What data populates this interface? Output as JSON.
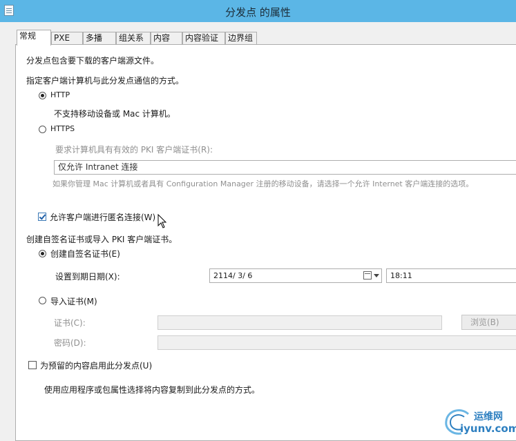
{
  "window": {
    "title": "分发点 的属性"
  },
  "tabs": [
    {
      "label": "常规",
      "active": true
    },
    {
      "label": "PXE"
    },
    {
      "label": "多播"
    },
    {
      "label": "组关系"
    },
    {
      "label": "内容"
    },
    {
      "label": "内容验证"
    },
    {
      "label": "边界组"
    }
  ],
  "general": {
    "desc": "分发点包含要下载的客户端源文件。",
    "comm_label": "指定客户端计算机与此分发点通信的方式。",
    "http": {
      "label": "HTTP",
      "selected": true,
      "note": "不支持移动设备或 Mac 计算机。"
    },
    "https": {
      "label": "HTTPS",
      "selected": false,
      "pki_label": "要求计算机具有有效的 PKI 客户端证书(R):",
      "dropdown_value": "仅允许 Intranet 连接",
      "hint": "如果你管理 Mac 计算机或者具有 Configuration Manager 注册的移动设备，请选择一个允许 Internet 客户端连接的选项。"
    },
    "anonymous": {
      "label": "允许客户端进行匿名连接(W)",
      "checked": true
    },
    "cert_section_label": "创建自签名证书或导入 PKI 客户端证书。",
    "self_signed": {
      "label": "创建自签名证书(E)",
      "selected": true,
      "expiry_label": "设置到期日期(X):",
      "expiry_date": "2114/ 3/ 6",
      "expiry_time": "18:11"
    },
    "import_cert": {
      "label": "导入证书(M)",
      "selected": false,
      "cert_label": "证书(C):",
      "cert_value": "",
      "browse_label": "浏览(B)",
      "password_label": "密码(D):",
      "password_value": ""
    },
    "prestaged": {
      "label": "为预留的内容启用此分发点(U)",
      "checked": false,
      "note": "使用应用程序或包属性选择将内容复制到此分发点的方式。"
    }
  },
  "watermark": {
    "cn": "运维网",
    "en": "iyunv.com"
  }
}
